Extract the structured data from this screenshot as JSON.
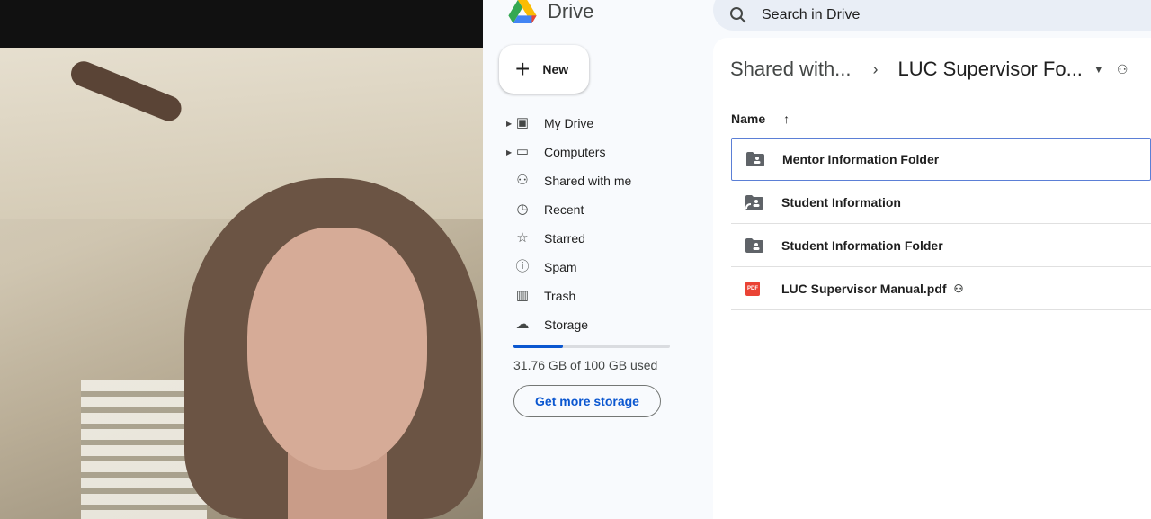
{
  "app": {
    "name": "Drive"
  },
  "search": {
    "placeholder": "Search in Drive"
  },
  "new_button": "New",
  "nav": [
    {
      "label": "My Drive",
      "icon": "my-drive-icon"
    },
    {
      "label": "Computers",
      "icon": "computers-icon"
    },
    {
      "label": "Shared with me",
      "icon": "shared-icon"
    },
    {
      "label": "Recent",
      "icon": "clock-icon"
    },
    {
      "label": "Starred",
      "icon": "star-icon"
    },
    {
      "label": "Spam",
      "icon": "spam-icon"
    },
    {
      "label": "Trash",
      "icon": "trash-icon"
    },
    {
      "label": "Storage",
      "icon": "cloud-icon"
    }
  ],
  "storage": {
    "used_text": "31.76 GB of 100 GB used",
    "fraction": 0.3176,
    "button": "Get more storage"
  },
  "breadcrumb": {
    "parent": "Shared with...",
    "current": "LUC Supervisor Fo..."
  },
  "columns": {
    "name": "Name"
  },
  "files": [
    {
      "name": "Mentor Information Folder",
      "type": "shared-folder"
    },
    {
      "name": "Student Information",
      "type": "folder-shortcut"
    },
    {
      "name": "Student Information Folder",
      "type": "shared-folder"
    },
    {
      "name": "LUC Supervisor Manual.pdf",
      "type": "pdf",
      "shared": true
    }
  ],
  "colors": {
    "accent": "#0b57d0",
    "pdf": "#ea4335"
  }
}
